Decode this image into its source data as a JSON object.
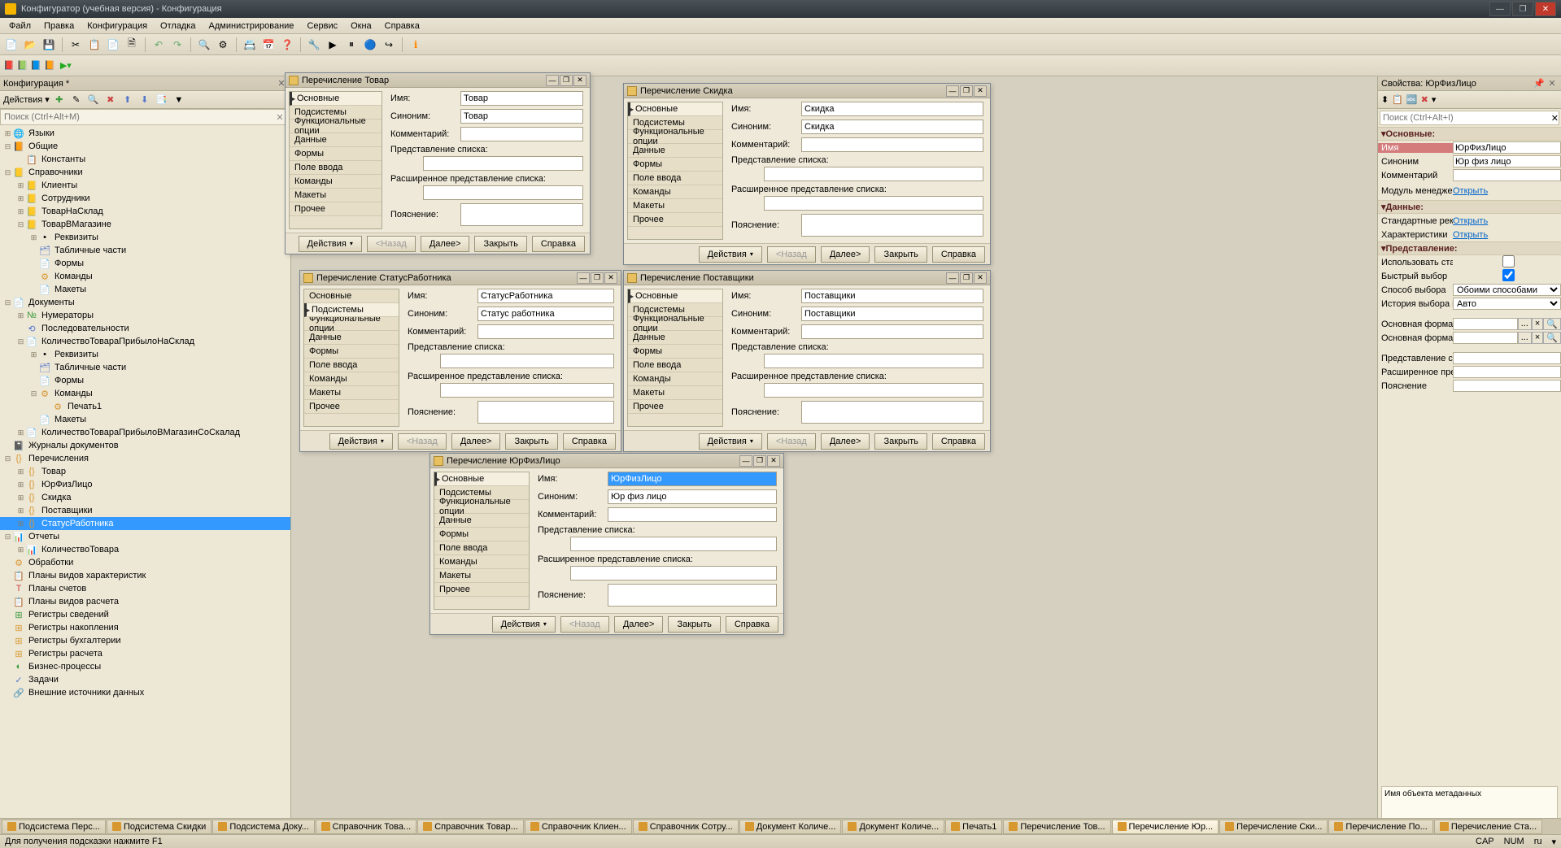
{
  "titlebar": {
    "title": "Конфигуратор (учебная версия) - Конфигурация"
  },
  "menu": [
    "Файл",
    "Правка",
    "Конфигурация",
    "Отладка",
    "Администрирование",
    "Сервис",
    "Окна",
    "Справка"
  ],
  "config_panel": {
    "title": "Конфигурация *",
    "actions": "Действия",
    "search_ph": "Поиск (Ctrl+Alt+M)"
  },
  "tree": [
    {
      "d": 0,
      "t": "⊞",
      "i": "🌐",
      "l": "Языки",
      "c": "ic-b"
    },
    {
      "d": 0,
      "t": "⊟",
      "i": "📙",
      "l": "Общие",
      "c": "ic-y"
    },
    {
      "d": 1,
      "t": "",
      "i": "📋",
      "l": "Константы",
      "c": "ic-y"
    },
    {
      "d": 0,
      "t": "⊟",
      "i": "📒",
      "l": "Справочники",
      "c": "ic-y"
    },
    {
      "d": 1,
      "t": "⊞",
      "i": "📒",
      "l": "Клиенты",
      "c": "ic-y"
    },
    {
      "d": 1,
      "t": "⊞",
      "i": "📒",
      "l": "Сотрудники",
      "c": "ic-y"
    },
    {
      "d": 1,
      "t": "⊞",
      "i": "📒",
      "l": "ТоварНаСклад",
      "c": "ic-y"
    },
    {
      "d": 1,
      "t": "⊟",
      "i": "📒",
      "l": "ТоварВМагазине",
      "c": "ic-y"
    },
    {
      "d": 2,
      "t": "⊞",
      "i": "•",
      "l": "Реквизиты",
      "c": ""
    },
    {
      "d": 2,
      "t": "",
      "i": "🗂",
      "l": "Табличные части",
      "c": "ic-b"
    },
    {
      "d": 2,
      "t": "",
      "i": "📄",
      "l": "Формы",
      "c": "ic-b"
    },
    {
      "d": 2,
      "t": "",
      "i": "⚙",
      "l": "Команды",
      "c": "ic-y"
    },
    {
      "d": 2,
      "t": "",
      "i": "📄",
      "l": "Макеты",
      "c": "ic-y"
    },
    {
      "d": 0,
      "t": "⊟",
      "i": "📄",
      "l": "Документы",
      "c": "ic-b"
    },
    {
      "d": 1,
      "t": "⊞",
      "i": "№",
      "l": "Нумераторы",
      "c": "ic-g"
    },
    {
      "d": 1,
      "t": "",
      "i": "⟲",
      "l": "Последовательности",
      "c": "ic-b"
    },
    {
      "d": 1,
      "t": "⊟",
      "i": "📄",
      "l": "КоличествоТовараПрибылоНаСклад",
      "c": "ic-y"
    },
    {
      "d": 2,
      "t": "⊞",
      "i": "•",
      "l": "Реквизиты",
      "c": ""
    },
    {
      "d": 2,
      "t": "",
      "i": "🗂",
      "l": "Табличные части",
      "c": "ic-b"
    },
    {
      "d": 2,
      "t": "",
      "i": "📄",
      "l": "Формы",
      "c": "ic-b"
    },
    {
      "d": 2,
      "t": "⊟",
      "i": "⚙",
      "l": "Команды",
      "c": "ic-y"
    },
    {
      "d": 3,
      "t": "",
      "i": "⚙",
      "l": "Печать1",
      "c": "ic-y"
    },
    {
      "d": 2,
      "t": "",
      "i": "📄",
      "l": "Макеты",
      "c": "ic-y"
    },
    {
      "d": 1,
      "t": "⊞",
      "i": "📄",
      "l": "КоличествоТовараПрибылоВМагазинСоСкалад",
      "c": "ic-y"
    },
    {
      "d": 0,
      "t": "",
      "i": "📓",
      "l": "Журналы документов",
      "c": "ic-b"
    },
    {
      "d": 0,
      "t": "⊟",
      "i": "{}",
      "l": "Перечисления",
      "c": "ic-y"
    },
    {
      "d": 1,
      "t": "⊞",
      "i": "{}",
      "l": "Товар",
      "c": "ic-y"
    },
    {
      "d": 1,
      "t": "⊞",
      "i": "{}",
      "l": "ЮрФизЛицо",
      "c": "ic-y"
    },
    {
      "d": 1,
      "t": "⊞",
      "i": "{}",
      "l": "Скидка",
      "c": "ic-y"
    },
    {
      "d": 1,
      "t": "⊞",
      "i": "{}",
      "l": "Поставщики",
      "c": "ic-y"
    },
    {
      "d": 1,
      "t": "⊞",
      "i": "{}",
      "l": "СтатусРаботника",
      "c": "ic-y",
      "sel": true
    },
    {
      "d": 0,
      "t": "⊟",
      "i": "📊",
      "l": "Отчеты",
      "c": "ic-y"
    },
    {
      "d": 1,
      "t": "⊞",
      "i": "📊",
      "l": "КоличествоТовара",
      "c": "ic-y"
    },
    {
      "d": 0,
      "t": "",
      "i": "⚙",
      "l": "Обработки",
      "c": "ic-y"
    },
    {
      "d": 0,
      "t": "",
      "i": "📋",
      "l": "Планы видов характеристик",
      "c": "ic-b"
    },
    {
      "d": 0,
      "t": "",
      "i": "T",
      "l": "Планы счетов",
      "c": "ic-r"
    },
    {
      "d": 0,
      "t": "",
      "i": "📋",
      "l": "Планы видов расчета",
      "c": "ic-b"
    },
    {
      "d": 0,
      "t": "",
      "i": "⊞",
      "l": "Регистры сведений",
      "c": "ic-g"
    },
    {
      "d": 0,
      "t": "",
      "i": "⊞",
      "l": "Регистры накопления",
      "c": "ic-y"
    },
    {
      "d": 0,
      "t": "",
      "i": "⊞",
      "l": "Регистры бухгалтерии",
      "c": "ic-y"
    },
    {
      "d": 0,
      "t": "",
      "i": "⊞",
      "l": "Регистры расчета",
      "c": "ic-y"
    },
    {
      "d": 0,
      "t": "",
      "i": "◐",
      "l": "Бизнес-процессы",
      "c": "ic-g"
    },
    {
      "d": 0,
      "t": "",
      "i": "✓",
      "l": "Задачи",
      "c": "ic-b"
    },
    {
      "d": 0,
      "t": "",
      "i": "🔗",
      "l": "Внешние источники данных",
      "c": "ic-g"
    }
  ],
  "side_tabs": [
    "Основные",
    "Подсистемы",
    "Функциональные опции",
    "Данные",
    "Формы",
    "Поле ввода",
    "Команды",
    "Макеты",
    "Прочее"
  ],
  "form_labels": {
    "name": "Имя:",
    "syn": "Синоним:",
    "com": "Комментарий:",
    "rep": "Представление списка:",
    "exrep": "Расширенное представление списка:",
    "expl": "Пояснение:"
  },
  "win_btns": {
    "act": "Действия",
    "back": "<Назад",
    "next": "Далее>",
    "close": "Закрыть",
    "help": "Справка"
  },
  "windows": {
    "tovar": {
      "title": "Перечисление Товар",
      "name": "Товар",
      "syn": "Товар"
    },
    "skidka": {
      "title": "Перечисление Скидка",
      "name": "Скидка",
      "syn": "Скидка"
    },
    "status": {
      "title": "Перечисление СтатусРаботника",
      "name": "СтатусРаботника",
      "syn": "Статус работника"
    },
    "post": {
      "title": "Перечисление Поставщики",
      "name": "Поставщики",
      "syn": "Поставщики"
    },
    "yur": {
      "title": "Перечисление ЮрФизЛицо",
      "name": "ЮрФизЛицо",
      "syn": "Юр физ лицо"
    }
  },
  "props": {
    "title": "Свойства: ЮрФизЛицо",
    "search_ph": "Поиск (Ctrl+Alt+I)",
    "sections": {
      "main": "▾Основные:",
      "data": "▾Данные:",
      "pres": "▾Представление:"
    },
    "rows": {
      "name_l": "Имя",
      "name_v": "ЮрФизЛицо",
      "syn_l": "Синоним",
      "syn_v": "Юр физ лицо",
      "com_l": "Комментарий",
      "com_v": "",
      "mod_l": "Модуль менеджера",
      "mod_v": "Открыть",
      "std_l": "Стандартные реквизи",
      "std_v": "Открыть",
      "char_l": "Характеристики",
      "char_v": "Открыть",
      "use_l": "Использовать станда",
      "fast_l": "Быстрый выбор",
      "way_l": "Способ выбора",
      "way_v": "Обоими способами",
      "hist_l": "История выбора при ",
      "hist_v": "Авто",
      "mf_l": "Основная форма спи",
      "mf2_l": "Основная форма выб",
      "ps_l": "Представление списк",
      "eps_l": "Расширенное предста",
      "exp_l": "Пояснение"
    },
    "desc": "Имя объекта метаданных"
  },
  "tabs": [
    "Подсистема Перс...",
    "Подсистема Скидки",
    "Подсистема Доку...",
    "Справочник Това...",
    "Справочник Товар...",
    "Справочник Клиен...",
    "Справочник Сотру...",
    "Документ Количе...",
    "Документ Количе...",
    "Печать1",
    "Перечисление Тов...",
    "Перечисление Юр...",
    "Перечисление Ски...",
    "Перечисление По...",
    "Перечисление Ста..."
  ],
  "status": {
    "left": "Для получения подсказки нажмите F1",
    "cap": "CAP",
    "num": "NUM",
    "lang": "ru"
  }
}
